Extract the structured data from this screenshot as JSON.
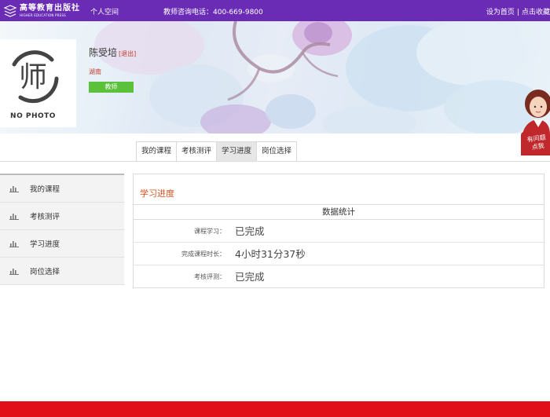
{
  "header": {
    "logo_cn": "高等教育出版社",
    "logo_en": "HIGHER EDUCATION PRESS",
    "nav_personal_space": "个人空间",
    "hotline": "教师咨询电话：400-669-9800",
    "set_homepage": "设为首页",
    "link_separator": "|",
    "add_favorite": "点击收藏",
    "bar_color": "#6a2bb5"
  },
  "profile": {
    "avatar_glyph": "师",
    "avatar_caption": "NO PHOTO",
    "name": "陈受培",
    "logout_label": "[退出]",
    "region": "湖南",
    "role": "教师"
  },
  "help_widget": {
    "line1": "有问题",
    "line2": "点我"
  },
  "tabs": [
    {
      "label": "我的课程",
      "active": false
    },
    {
      "label": "考核测评",
      "active": false
    },
    {
      "label": "学习进度",
      "active": true
    },
    {
      "label": "岗位选择",
      "active": false
    }
  ],
  "sidebar": {
    "items": [
      {
        "label": "我的课程",
        "icon": "bar-chart-icon"
      },
      {
        "label": "考核测评",
        "icon": "bar-chart-icon"
      },
      {
        "label": "学习进度",
        "icon": "bar-chart-icon"
      },
      {
        "label": "岗位选择",
        "icon": "bar-chart-icon"
      }
    ]
  },
  "main": {
    "title": "学习进度",
    "stats_header": "数据统计",
    "rows": [
      {
        "key": "课程学习：",
        "value": "已完成"
      },
      {
        "key": "完成课程时长：",
        "value": "4小时31分37秒"
      },
      {
        "key": "考核评测：",
        "value": "已完成"
      }
    ]
  },
  "colors": {
    "accent_orange": "#d0531f",
    "role_badge_green": "#5bc03a",
    "footer_red": "#e10f17"
  }
}
